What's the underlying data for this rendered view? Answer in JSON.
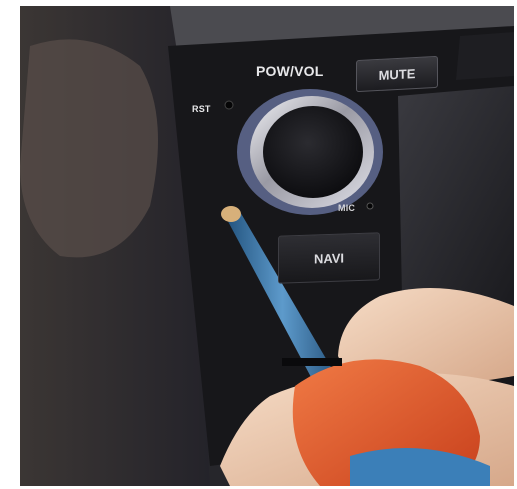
{
  "photo": {
    "subject": "car-stereo-head-unit",
    "panel_labels": {
      "pow_vol": "POW/VOL",
      "rst": "RST",
      "mic": "MIC"
    },
    "buttons": {
      "mute": "MUTE",
      "navi": "NAVI"
    },
    "colors": {
      "panel": "#17171a",
      "knob_ring": "#c8c8d0",
      "screwdriver_handle": "#e8572a",
      "screwdriver_tip": "#3d7fb5",
      "skin": "#e8c4a8"
    }
  }
}
